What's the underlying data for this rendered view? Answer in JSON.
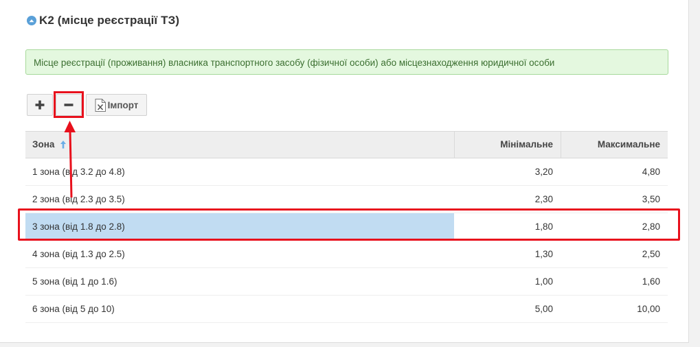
{
  "section": {
    "title": "K2 (місце реєстрації ТЗ)",
    "collapse_icon": "chevron-up-icon"
  },
  "note": {
    "text": "Місце реєстрації (проживання) власника транспортного засобу (фізичної особи) або місцезнаходження юридичної особи"
  },
  "toolbar": {
    "add_icon": "plus-icon",
    "remove_icon": "minus-icon",
    "import_icon": "excel-icon",
    "import_label": "Імпорт"
  },
  "grid": {
    "columns": {
      "zone": "Зона",
      "min": "Мінімальне",
      "max": "Максимальне"
    },
    "sort_icon": "arrow-up-icon",
    "selected_row": 2,
    "rows": [
      {
        "zone": "1 зона (від 3.2 до 4.8)",
        "min": "3,20",
        "max": "4,80"
      },
      {
        "zone": "2 зона (від 2.3 до 3.5)",
        "min": "2,30",
        "max": "3,50"
      },
      {
        "zone": "3 зона (від 1.8 до 2.8)",
        "min": "1,80",
        "max": "2,80"
      },
      {
        "zone": "4 зона (від 1.3 до 2.5)",
        "min": "1,30",
        "max": "2,50"
      },
      {
        "zone": "5 зона (від 1 до 1.6)",
        "min": "1,00",
        "max": "1,60"
      },
      {
        "zone": "6 зона (від 5 до 10)",
        "min": "5,00",
        "max": "10,00"
      }
    ]
  },
  "annotations": {
    "color": "#e8101c"
  }
}
